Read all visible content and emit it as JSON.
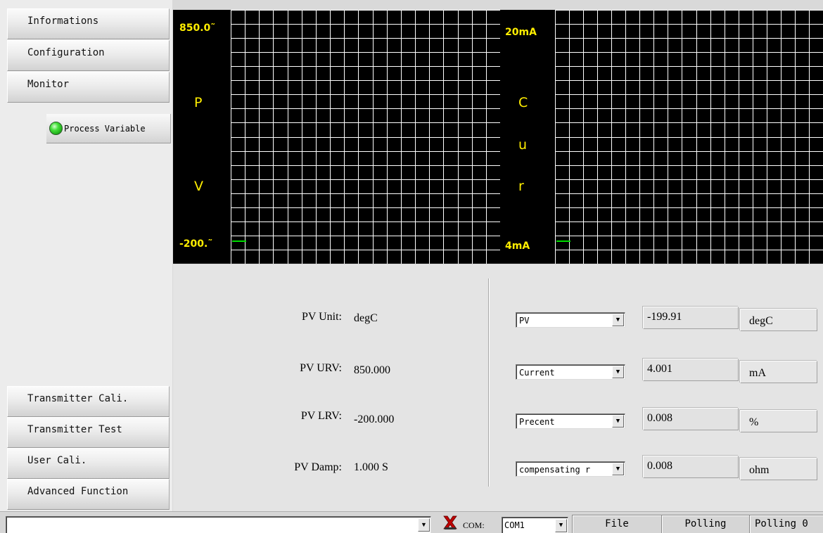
{
  "sidebar": {
    "top_items": [
      {
        "label": "Informations"
      },
      {
        "label": "Configuration"
      },
      {
        "label": "Monitor"
      }
    ],
    "sub_item": {
      "label": "Process Variable",
      "status_icon": "green-led-icon"
    },
    "bottom_items": [
      {
        "label": "Transmitter Cali."
      },
      {
        "label": "Transmitter Test"
      },
      {
        "label": "User Cali."
      },
      {
        "label": "Advanced Function"
      }
    ]
  },
  "charts": {
    "pv": {
      "max_label": "850.0˜",
      "min_label": "-200.˜",
      "letters": [
        "P",
        "V"
      ],
      "trace_color": "#00dd00",
      "text_color": "#ffee00"
    },
    "cur": {
      "max_label": "20mA",
      "min_label": "4mA",
      "letters": [
        "C",
        "u",
        "r"
      ],
      "trace_color": "#00dd00",
      "text_color": "#ffee00"
    },
    "grid_color": "#ffffff"
  },
  "panel": {
    "fields": [
      {
        "label": "PV Unit:",
        "value": "degC"
      },
      {
        "label": "PV URV:",
        "value": "850.000"
      },
      {
        "label": "PV LRV:",
        "value": "-200.000"
      },
      {
        "label": "PV Damp:",
        "value": "1.000 S"
      }
    ],
    "readouts": [
      {
        "select": "PV",
        "value": "-199.91",
        "unit": "degC"
      },
      {
        "select": "Current",
        "value": "4.001",
        "unit": "mA"
      },
      {
        "select": "Precent",
        "value": "0.008",
        "unit": "%"
      },
      {
        "select": "compensating r",
        "value": "0.008",
        "unit": "ohm"
      }
    ]
  },
  "statusbar": {
    "command_value": "",
    "com_label": "COM:",
    "com_port": "COM1",
    "connection_icon": "disconnected-x-icon",
    "cells": [
      "File",
      "Polling",
      "Polling 0"
    ]
  }
}
